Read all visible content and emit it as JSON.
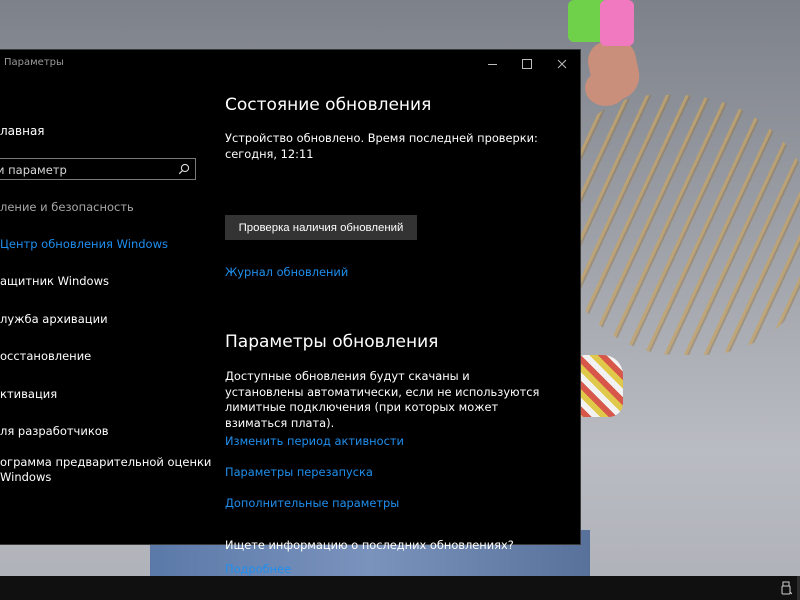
{
  "window": {
    "title": "Параметры",
    "controls": [
      "minimize",
      "maximize",
      "close"
    ]
  },
  "sidebar": {
    "home": "лавная",
    "search": {
      "value": "и параметр",
      "icon": "search-icon"
    },
    "section_heading": "ление и безопасность",
    "items": [
      {
        "label": "Центр обновления Windows",
        "active": true
      },
      {
        "label": "ащитник Windows",
        "active": false
      },
      {
        "label": "лужба архивации",
        "active": false
      },
      {
        "label": "осстановление",
        "active": false
      },
      {
        "label": "ктивация",
        "active": false
      },
      {
        "label": "ля разработчиков",
        "active": false
      },
      {
        "label_line1": "ограмма предварительной оценки",
        "label_line2": "Windows",
        "active": false
      }
    ]
  },
  "main": {
    "status_heading": "Состояние обновления",
    "status_text": "Устройство обновлено. Время последней проверки: сегодня, 12:11",
    "check_button": "Проверка наличия обновлений",
    "history_link": "Журнал обновлений",
    "settings_heading": "Параметры обновления",
    "settings_text": "Доступные обновления будут скачаны и установлены автоматически, если не используются лимитные подключения (при которых может взиматься плата).",
    "links": [
      "Изменить период активности",
      "Параметры перезапуска",
      "Дополнительные параметры"
    ],
    "info_question": "Ищете информацию о последних обновлениях?",
    "more_link": "Подробнее"
  },
  "colors": {
    "window_bg": "#000000",
    "accent": "#1f8fef",
    "button_bg": "#333333",
    "taskbar_bg": "#101010"
  }
}
